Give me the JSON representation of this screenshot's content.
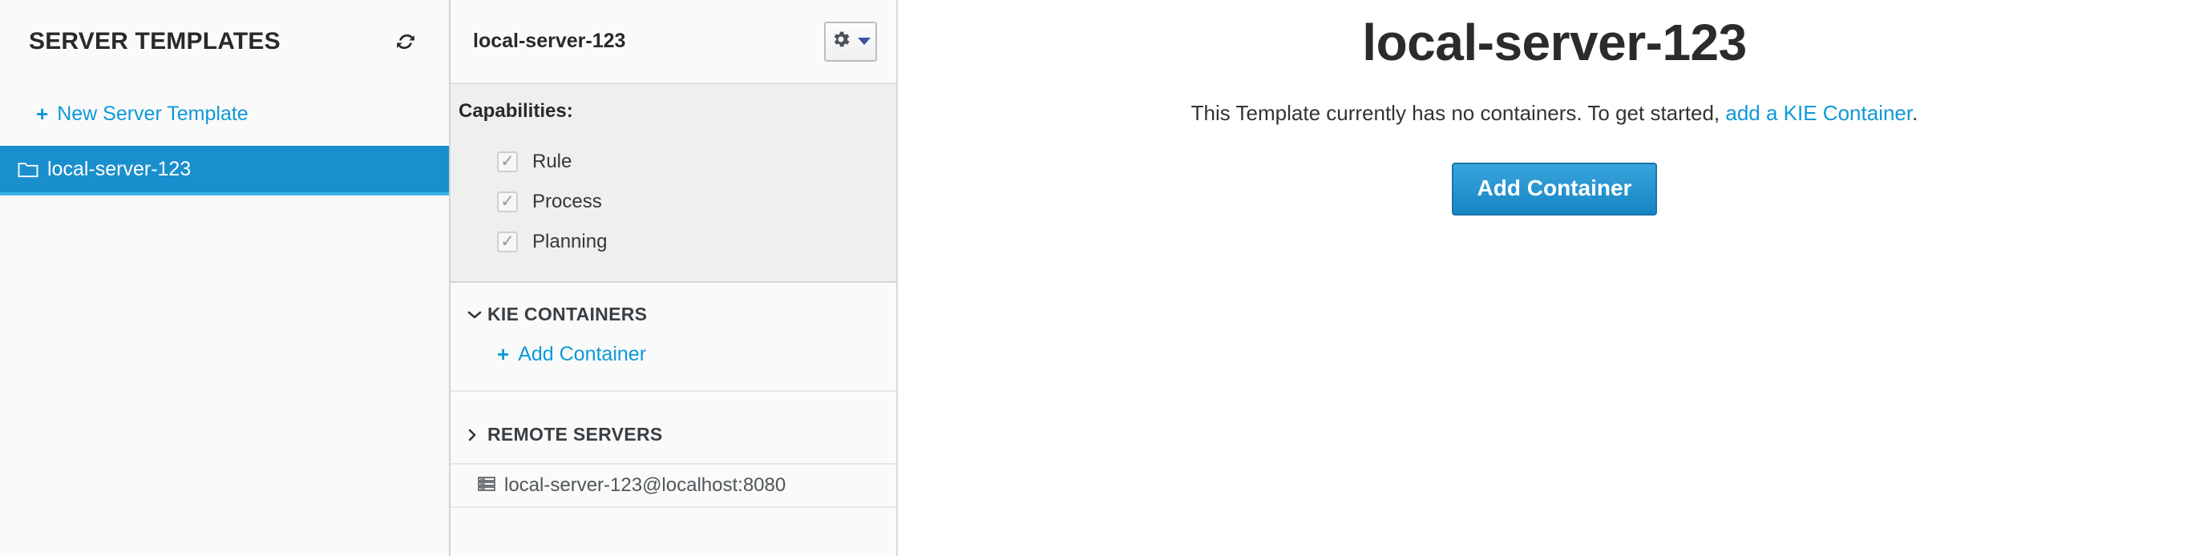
{
  "sidebar": {
    "title": "SERVER TEMPLATES",
    "refresh_icon": "refresh-icon",
    "new_template": {
      "plus": "+",
      "label": "New Server Template"
    },
    "items": [
      {
        "label": "local-server-123",
        "icon": "folder-icon",
        "selected": true
      }
    ]
  },
  "midpanel": {
    "header": {
      "title": "local-server-123",
      "gear_icon": "gear-icon",
      "caret_icon": "chevron-down-icon"
    },
    "capabilities": {
      "label": "Capabilities:",
      "check_glyph": "✓",
      "items": [
        {
          "label": "Rule",
          "checked": true
        },
        {
          "label": "Process",
          "checked": true
        },
        {
          "label": "Planning",
          "checked": true
        }
      ]
    },
    "kie_containers": {
      "caret": "⌄",
      "title": "KIE CONTAINERS",
      "add_link": {
        "plus": "+",
        "label": "Add Container"
      }
    },
    "remote_servers": {
      "caret": "›",
      "title": "REMOTE SERVERS",
      "rows": [
        {
          "label": "local-server-123@localhost:8080",
          "icon": "server-icon"
        }
      ]
    }
  },
  "content": {
    "title": "local-server-123",
    "message_prefix": "This Template currently has no containers. To get started, ",
    "message_link": "add a KIE Container",
    "message_suffix": ".",
    "primary_button": "Add Container"
  },
  "colors": {
    "accent_blue": "#0e99d8",
    "selected_row": "#1a8fcd",
    "selected_underline": "#3ab3e8",
    "button_blue": "#1785c4",
    "panel_grey": "#efefef",
    "page_bg": "#fafafa"
  }
}
